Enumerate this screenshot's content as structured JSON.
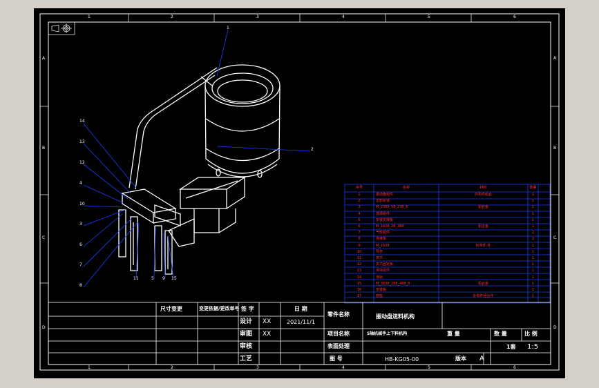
{
  "frame": {
    "col_labels": [
      "1",
      "2",
      "3",
      "4",
      "5",
      "6"
    ],
    "row_labels": [
      "A",
      "B",
      "C",
      "D"
    ]
  },
  "balloons": [
    "1",
    "2",
    "14",
    "13",
    "12",
    "4",
    "10",
    "3",
    "6",
    "7",
    "8",
    "11",
    "5",
    "9",
    "15"
  ],
  "bom": {
    "headers": [
      "序号",
      "名称",
      "材料",
      "数量"
    ],
    "rows": [
      {
        "no": "1",
        "name": "振动盘组件",
        "mat": "外购件组合",
        "qty": "1"
      },
      {
        "no": "2",
        "name": "出料轨道",
        "mat": "",
        "qty": "1"
      },
      {
        "no": "3",
        "name": "M_2389_58_238_8",
        "mat": "铝合金",
        "qty": "1"
      },
      {
        "no": "4",
        "name": "直振组件",
        "mat": "",
        "qty": "1"
      },
      {
        "no": "5",
        "name": "安装支撑板",
        "mat": "",
        "qty": "1"
      },
      {
        "no": "6",
        "name": "M_1628_28_388",
        "mat": "铝合金",
        "qty": "1"
      },
      {
        "no": "7",
        "name": "气缸组件",
        "mat": "",
        "qty": "2"
      },
      {
        "no": "8",
        "name": "连接板",
        "mat": "",
        "qty": "2"
      },
      {
        "no": "9",
        "name": "M_1638",
        "mat": "标准件-外",
        "qty": "1"
      },
      {
        "no": "10",
        "name": "导杆",
        "mat": "",
        "qty": "1"
      },
      {
        "no": "11",
        "name": "夹爪",
        "mat": "",
        "qty": "1"
      },
      {
        "no": "12",
        "name": "夹爪固定板",
        "mat": "",
        "qty": "1"
      },
      {
        "no": "13",
        "name": "滑块组件",
        "mat": "",
        "qty": "1"
      },
      {
        "no": "14",
        "name": "滑轨",
        "mat": "",
        "qty": "1"
      },
      {
        "no": "15",
        "name": "M_3838_268_488_8",
        "mat": "铝合金",
        "qty": "1"
      },
      {
        "no": "16",
        "name": "安装板",
        "mat": "",
        "qty": "1"
      },
      {
        "no": "17",
        "name": "底座",
        "mat": "外购件组合件",
        "qty": "1"
      }
    ]
  },
  "title_block": {
    "chg_mark": "尺寸变更",
    "chg_doc": "变更依据/更改单号",
    "sign": "签 字",
    "date_h": "日 期",
    "design": "设计",
    "design_by": "XX",
    "design_date": "2021/11/1",
    "check": "审图",
    "check_by": "XX",
    "review": "审核",
    "process": "工艺",
    "part_name_h": "零件名称",
    "part_name": "振动盘送料机构",
    "proj_h": "项目名称",
    "proj": "5轴机械手上下料机构",
    "weight_h": "重 量",
    "qty_h": "数 量",
    "scale_h": "比 例",
    "qty": "1套",
    "scale": "1:5",
    "surface_h": "表面处理",
    "drawing_h": "图 号",
    "drawing_no": "HB-KG05-00",
    "rev_h": "版本",
    "rev": "A"
  }
}
